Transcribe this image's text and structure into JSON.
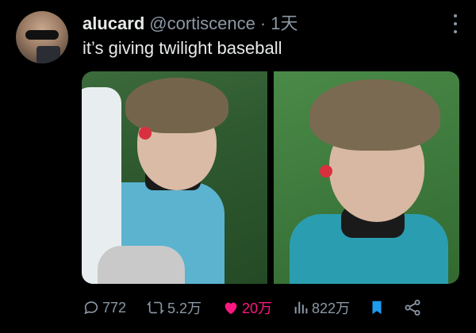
{
  "author": {
    "name": "alucard",
    "handle": "@cortiscence",
    "time": "1天"
  },
  "tweet": {
    "text": "it’s giving twilight baseball"
  },
  "actions": {
    "replies": "772",
    "retweets": "5.2万",
    "likes": "20万",
    "views": "822万"
  },
  "colors": {
    "background": "#000000",
    "text": "#e7e9ea",
    "muted": "#8b98a5",
    "like": "#f91880",
    "bookmark": "#1d9bf0"
  },
  "icons": [
    "more-icon",
    "reply-icon",
    "retweet-icon",
    "heart-icon",
    "views-icon",
    "bookmark-icon",
    "share-icon"
  ]
}
